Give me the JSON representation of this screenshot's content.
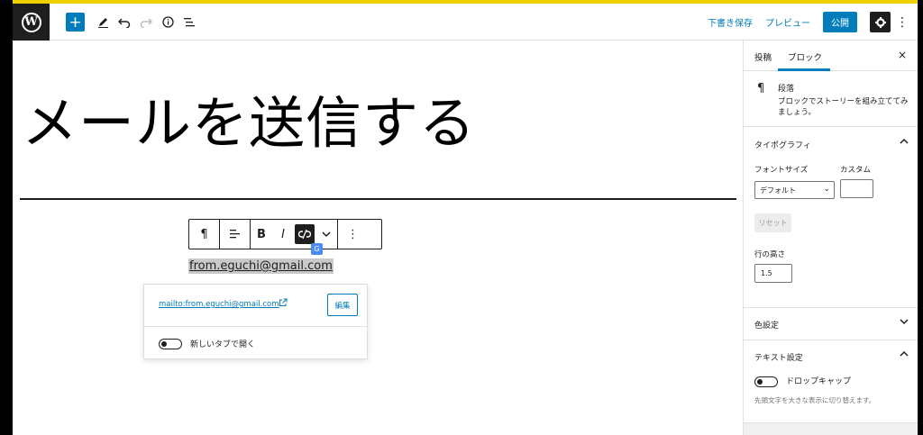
{
  "header": {
    "save_draft": "下書き保存",
    "preview": "プレビュー",
    "publish": "公開",
    "icons": [
      "wordpress-logo",
      "plus-icon",
      "pencil-icon",
      "undo-icon",
      "redo-icon",
      "info-icon",
      "list-view-icon",
      "gear-icon",
      "more-vertical-icon"
    ]
  },
  "editor": {
    "title": "メールを送信する",
    "selected_text": "from.eguchi@gmail.com"
  },
  "block_toolbar": {
    "paragraph_icon": "¶",
    "bold": "B",
    "italic": "I"
  },
  "link_popover": {
    "url": "mailto:from.eguchi@gmail.com",
    "edit_button": "編集",
    "new_tab_label": "新しいタブで開く"
  },
  "sidebar": {
    "tabs": [
      "投稿",
      "ブロック"
    ],
    "active_tab": "ブロック",
    "close": "×",
    "block_card": {
      "name": "段落",
      "description": "ブロックでストーリーを組み立ててみましょう。"
    },
    "typography": {
      "title": "タイポグラフィ",
      "font_size_label": "フォントサイズ",
      "custom_label": "カスタム",
      "font_size_value": "デフォルト",
      "reset": "リセット",
      "line_height_label": "行の高さ",
      "line_height_value": "1.5"
    },
    "color_settings": {
      "title": "色設定"
    },
    "text_settings": {
      "title": "テキスト設定",
      "drop_cap_label": "ドロップキャップ",
      "drop_cap_help": "先頭文字を大きな表示に切り替えます。"
    }
  },
  "colors": {
    "accent": "#007cba",
    "dark": "#1e1e1e",
    "top_stripe": "#f0d000"
  }
}
